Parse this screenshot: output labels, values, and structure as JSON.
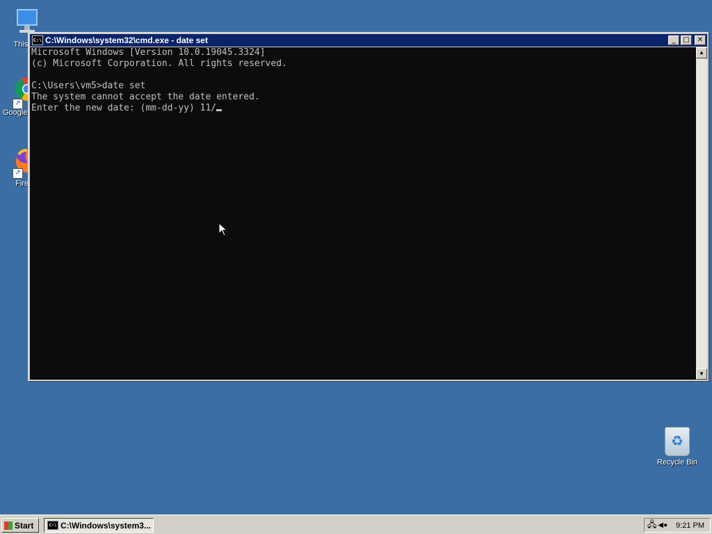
{
  "desktop": {
    "icons": [
      {
        "name": "this-pc",
        "label": "This PC",
        "icon": "monitor-icon"
      },
      {
        "name": "google-chrome",
        "label": "Google Chrome",
        "icon": "chrome-icon"
      },
      {
        "name": "firefox",
        "label": "Firefox",
        "icon": "firefox-icon"
      },
      {
        "name": "recycle-bin",
        "label": "Recycle Bin",
        "icon": "recycle-bin-icon"
      }
    ]
  },
  "window": {
    "title": "C:\\Windows\\system32\\cmd.exe - date  set",
    "icon_text": "C:\\",
    "console_lines": [
      "Microsoft Windows [Version 10.0.19045.3324]",
      "(c) Microsoft Corporation. All rights reserved.",
      "",
      "C:\\Users\\vm5>date set",
      "The system cannot accept the date entered.",
      "Enter the new date: (mm-dd-yy) 11/"
    ],
    "colors": {
      "console_bg": "#0c0c0c",
      "console_fg": "#c0c0c0",
      "titlebar": "#0a246a"
    }
  },
  "taskbar": {
    "start_label": "Start",
    "task_label": "C:\\Windows\\system3...",
    "clock": "9:21 PM"
  },
  "desktop_color": "#3a6ea5"
}
